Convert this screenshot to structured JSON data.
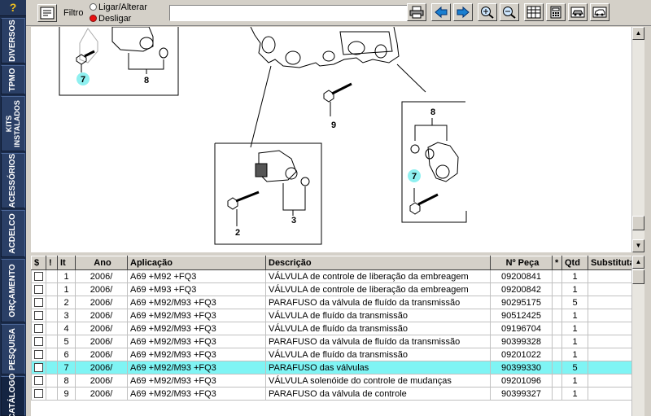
{
  "sidebar": {
    "help": "?",
    "tabs": [
      {
        "id": "diversos",
        "label": "DIVERSOS"
      },
      {
        "id": "tpmo",
        "label": "TPMO"
      },
      {
        "id": "kits",
        "label": "KITS INSTALADOS"
      },
      {
        "id": "acessorios",
        "label": "ACESSÓRIOS"
      },
      {
        "id": "acdelco",
        "label": "ACDELCO"
      },
      {
        "id": "orcamento",
        "label": "ORÇAMENTO"
      },
      {
        "id": "pesquisa",
        "label": "PESQUISA"
      },
      {
        "id": "catalogo",
        "label": "CATÁLOGO"
      }
    ]
  },
  "toolbar": {
    "filter_label": "Filtro",
    "radio_on_label": "Ligar/Alterar",
    "radio_off_label": "Desligar",
    "filter_value": ""
  },
  "diagram": {
    "callouts": [
      "7",
      "8",
      "9",
      "8",
      "7",
      "2",
      "3"
    ]
  },
  "table": {
    "headers": [
      "$",
      "!",
      "It",
      "Ano",
      "Aplicação",
      "Descrição",
      "Nº Peça",
      "*",
      "Qtd",
      "Substituta"
    ],
    "rows": [
      {
        "it": "1",
        "ano": "2006/",
        "aplicacao": "A69 +M92 +FQ3",
        "descricao": "VÁLVULA de controle de liberação da embreagem",
        "peca": "09200841",
        "star": "",
        "qtd": "1",
        "subst": ""
      },
      {
        "it": "1",
        "ano": "2006/",
        "aplicacao": "A69 +M93 +FQ3",
        "descricao": "VÁLVULA de controle de liberação da embreagem",
        "peca": "09200842",
        "star": "",
        "qtd": "1",
        "subst": ""
      },
      {
        "it": "2",
        "ano": "2006/",
        "aplicacao": "A69 +M92/M93 +FQ3",
        "descricao": "PARAFUSO da válvula de fluído da transmissão",
        "peca": "90295175",
        "star": "",
        "qtd": "5",
        "subst": ""
      },
      {
        "it": "3",
        "ano": "2006/",
        "aplicacao": "A69 +M92/M93 +FQ3",
        "descricao": "VÁLVULA de fluído da transmissão",
        "peca": "90512425",
        "star": "",
        "qtd": "1",
        "subst": ""
      },
      {
        "it": "4",
        "ano": "2006/",
        "aplicacao": "A69 +M92/M93 +FQ3",
        "descricao": "VÁLVULA de fluído da transmissão",
        "peca": "09196704",
        "star": "",
        "qtd": "1",
        "subst": ""
      },
      {
        "it": "5",
        "ano": "2006/",
        "aplicacao": "A69 +M92/M93 +FQ3",
        "descricao": "PARAFUSO da válvula de fluído da transmissão",
        "peca": "90399328",
        "star": "",
        "qtd": "1",
        "subst": ""
      },
      {
        "it": "6",
        "ano": "2006/",
        "aplicacao": "A69 +M92/M93 +FQ3",
        "descricao": "VÁLVULA de fluído da transmissão",
        "peca": "09201022",
        "star": "",
        "qtd": "1",
        "subst": ""
      },
      {
        "it": "7",
        "ano": "2006/",
        "aplicacao": "A69 +M92/M93 +FQ3",
        "descricao": "PARAFUSO das válvulas",
        "peca": "90399330",
        "star": "",
        "qtd": "5",
        "subst": "",
        "selected": true
      },
      {
        "it": "8",
        "ano": "2006/",
        "aplicacao": "A69 +M92/M93 +FQ3",
        "descricao": "VÁLVULA solenóide do controle de mudanças",
        "peca": "09201096",
        "star": "",
        "qtd": "1",
        "subst": ""
      },
      {
        "it": "9",
        "ano": "2006/",
        "aplicacao": "A69 +M92/M93 +FQ3",
        "descricao": "PARAFUSO da válvula de controle",
        "peca": "90399327",
        "star": "",
        "qtd": "1",
        "subst": ""
      }
    ]
  },
  "colors": {
    "sidebar": "#1c2d4c",
    "selected_row": "#7ff4f4",
    "highlight_callout": "#8ff0f0"
  }
}
